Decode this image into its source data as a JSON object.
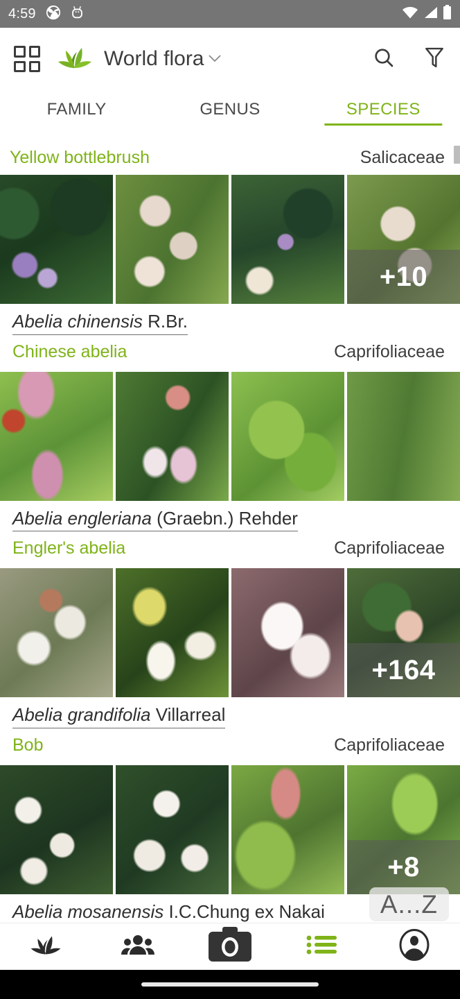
{
  "statusbar": {
    "time": "4:59",
    "icons": [
      "camera-shutter-icon",
      "android-debug-icon"
    ],
    "right_icons": [
      "wifi-icon",
      "cellular-signal-icon",
      "battery-full-icon"
    ]
  },
  "appbar": {
    "grid_icon": "grid-view-icon",
    "logo_icon": "leaf-logo-icon",
    "title": "World flora",
    "dropdown_icon": "chevron-down-icon",
    "search_icon": "search-icon",
    "filter_icon": "filter-funnel-icon"
  },
  "tabs": [
    {
      "label": "FAMILY",
      "active": false
    },
    {
      "label": "GENUS",
      "active": false
    },
    {
      "label": "SPECIES",
      "active": true
    }
  ],
  "filter_row": {
    "left_label": "Yellow bottlebrush",
    "right_label": "Salicaceae"
  },
  "az_bubble": {
    "label": "A...Z"
  },
  "species": [
    {
      "scientific_name": "Abelia chinensis",
      "authority": "R.Br.",
      "common_name": "Chinese abelia",
      "family": "Caprifoliaceae",
      "overflow_badge": "+10"
    },
    {
      "scientific_name": "Abelia engleriana",
      "authority": "(Graebn.) Rehder",
      "common_name": "Engler's abelia",
      "family": "Caprifoliaceae",
      "overflow_badge": ""
    },
    {
      "scientific_name": "Abelia grandifolia",
      "authority": "Villarreal",
      "common_name": "Bob",
      "family": "Caprifoliaceae",
      "overflow_badge": "+164"
    },
    {
      "scientific_name": "Abelia mosanensis",
      "authority": "I.C.Chung ex Nakai",
      "common_name": "",
      "family": "",
      "overflow_badge": "+8"
    }
  ],
  "bottomnav": [
    {
      "icon": "plants-leaf-icon",
      "active": false
    },
    {
      "icon": "people-group-icon",
      "active": false
    },
    {
      "icon": "camera-icon",
      "active": false
    },
    {
      "icon": "list-bullets-icon",
      "active": true
    },
    {
      "icon": "account-circle-icon",
      "active": false
    }
  ],
  "colors": {
    "accent_green": "#7fb318",
    "text_dark": "#3d3d3d",
    "statusbar_bg": "#757575",
    "badge_overlay": "rgba(90,90,90,0.55)"
  }
}
